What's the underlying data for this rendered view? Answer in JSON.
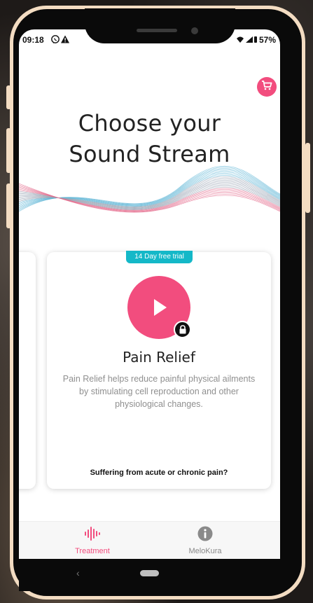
{
  "status_bar": {
    "time": "09:18",
    "left_icons": "whatsapp-icon, alert-icon",
    "battery": "57%"
  },
  "header": {
    "title_line1": "Choose your",
    "title_line2": "Sound Stream"
  },
  "cart": {
    "icon": "cart-icon"
  },
  "card": {
    "badge": "14 Day free trial",
    "title": "Pain Relief",
    "description": "Pain Relief helps reduce painful physical ailments by stimulating cell reproduction and other physiological changes.",
    "question": "Suffering from acute or chronic pain?",
    "locked": true
  },
  "bottom_nav": {
    "items": [
      {
        "label": "Treatment",
        "icon": "soundwave-icon",
        "active": true
      },
      {
        "label": "MeloKura",
        "icon": "info-icon",
        "active": false
      }
    ]
  },
  "colors": {
    "accent": "#f24d7e",
    "badge": "#14b8c8",
    "phone_frame": "#f3dcc2"
  }
}
